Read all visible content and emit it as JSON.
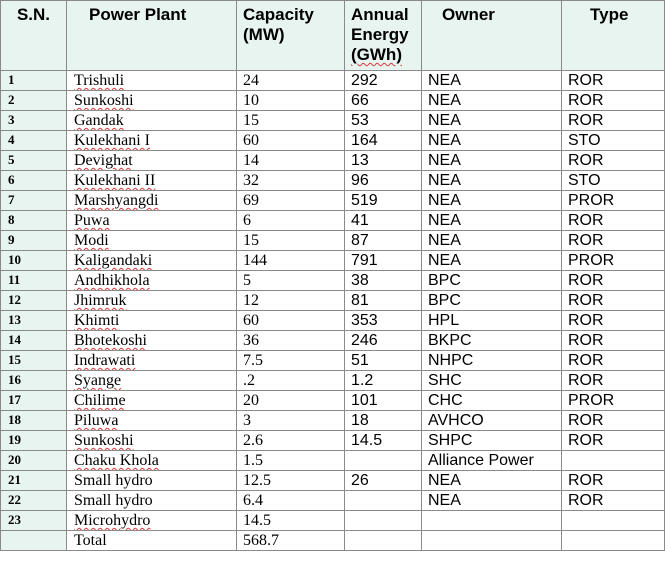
{
  "headers": {
    "sn": "S.N.",
    "plant": "Power Plant",
    "capacity": "Capacity (MW)",
    "energy_line1": "Annual",
    "energy_line2": "Energy",
    "energy_line3": "(GWh)",
    "owner": "Owner",
    "type": "Type"
  },
  "rows": [
    {
      "sn": "1",
      "plant": "Trishuli",
      "capacity": "24",
      "energy": "292",
      "owner": "NEA",
      "type": "ROR"
    },
    {
      "sn": "2",
      "plant": "Sunkoshi",
      "capacity": "10",
      "energy": "66",
      "owner": "NEA",
      "type": "ROR"
    },
    {
      "sn": "3",
      "plant": "Gandak",
      "capacity": "15",
      "energy": "53",
      "owner": "NEA",
      "type": "ROR"
    },
    {
      "sn": "4",
      "plant": "Kulekhani I",
      "capacity": "60",
      "energy": "164",
      "owner": "NEA",
      "type": "STO"
    },
    {
      "sn": "5",
      "plant": "Devighat",
      "capacity": "14",
      "energy": "13",
      "owner": "NEA",
      "type": "ROR"
    },
    {
      "sn": "6",
      "plant": "Kulekhani II",
      "capacity": "32",
      "energy": "96",
      "owner": "NEA",
      "type": "STO"
    },
    {
      "sn": "7",
      "plant": "Marshyangdi",
      "capacity": "69",
      "energy": "519",
      "owner": "NEA",
      "type": "PROR"
    },
    {
      "sn": "8",
      "plant": "Puwa",
      "capacity": "6",
      "energy": "41",
      "owner": "NEA",
      "type": "ROR"
    },
    {
      "sn": "9",
      "plant": "Modi",
      "capacity": "15",
      "energy": "87",
      "owner": "NEA",
      "type": "ROR"
    },
    {
      "sn": "10",
      "plant": "Kaligandaki",
      "capacity": "144",
      "energy": "791",
      "owner": "NEA",
      "type": "PROR"
    },
    {
      "sn": "11",
      "plant": "Andhikhola",
      "capacity": "5",
      "energy": "38",
      "owner": "BPC",
      "type": "ROR"
    },
    {
      "sn": "12",
      "plant": "Jhimruk",
      "capacity": "12",
      "energy": "81",
      "owner": "BPC",
      "type": "ROR"
    },
    {
      "sn": "13",
      "plant": "Khimti",
      "capacity": "60",
      "energy": "353",
      "owner": "HPL",
      "type": "ROR"
    },
    {
      "sn": "14",
      "plant": "Bhotekoshi",
      "capacity": "36",
      "energy": "246",
      "owner": "BKPC",
      "type": "ROR"
    },
    {
      "sn": "15",
      "plant": "Indrawati",
      "capacity": "7.5",
      "energy": "51",
      "owner": "NHPC",
      "type": "ROR"
    },
    {
      "sn": "16",
      "plant": "Syange",
      "capacity": ".2",
      "energy": "1.2",
      "owner": "SHC",
      "type": "ROR"
    },
    {
      "sn": "17",
      "plant": "Chilime",
      "capacity": "20",
      "energy": "101",
      "owner": "CHC",
      "type": "PROR"
    },
    {
      "sn": "18",
      "plant": "Piluwa",
      "capacity": "3",
      "energy": "18",
      "owner": "AVHCO",
      "type": "ROR"
    },
    {
      "sn": "19",
      "plant": "Sunkoshi",
      "capacity": "2.6",
      "energy": "14.5",
      "owner": "SHPC",
      "type": "ROR"
    },
    {
      "sn": "20",
      "plant": "Chaku Khola",
      "capacity": "1.5",
      "energy": "",
      "owner": "Alliance Power",
      "type": ""
    },
    {
      "sn": "21",
      "plant": "Small hydro",
      "capacity": "12.5",
      "energy": "26",
      "owner": "NEA",
      "type": "ROR"
    },
    {
      "sn": "22",
      "plant": "Small hydro",
      "capacity": "6.4",
      "energy": "",
      "owner": "NEA",
      "type": "ROR"
    },
    {
      "sn": "23",
      "plant": "Microhydro",
      "capacity": "14.5",
      "energy": "",
      "owner": "",
      "type": ""
    },
    {
      "sn": "",
      "plant": "Total",
      "capacity": "568.7",
      "energy": "",
      "owner": "",
      "type": ""
    }
  ],
  "spellcheck_underlined_plants": [
    "Trishuli",
    "Sunkoshi",
    "Gandak",
    "Kulekhani I",
    "Devighat",
    "Kulekhani II",
    "Marshyangdi",
    "Puwa",
    "Modi",
    "Kaligandaki",
    "Andhikhola",
    "Jhimruk",
    "Khimti",
    "Bhotekoshi",
    "Indrawati",
    "Syange",
    "Chilime",
    "Piluwa",
    "Chaku Khola",
    "Microhydro"
  ],
  "colors": {
    "header_bg": "#e7f4ef",
    "border": "#8a8a8a",
    "spellcheck": "#d93a3a"
  }
}
